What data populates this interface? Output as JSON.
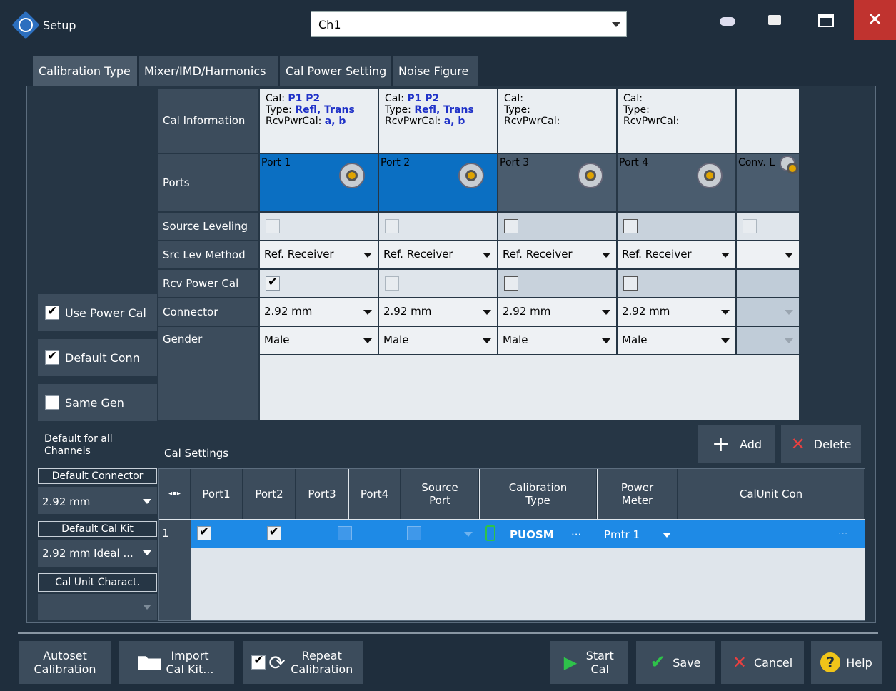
{
  "window": {
    "title": "Setup",
    "channel": "Ch1",
    "close": "✕"
  },
  "tabs": [
    "Calibration Type",
    "Mixer/IMD/Harmonics",
    "Cal Power Setting",
    "Noise Figure"
  ],
  "row_labels": {
    "cal_info": "Cal Information",
    "ports": "Ports",
    "source_leveling": "Source Leveling",
    "src_lev_method": "Src Lev Method",
    "rcv_power_cal": "Rcv Power Cal",
    "connector": "Connector",
    "gender": "Gender"
  },
  "ports": [
    {
      "name": "Port 1",
      "cal_label": "Cal:",
      "cal": "P1 P2",
      "type_label": "Type:",
      "type": "Refl, Trans",
      "rcv_label": "RcvPwrCal:",
      "rcv": "a, b",
      "method": "Ref. Receiver",
      "connector": "2.92 mm",
      "gender": "Male",
      "rcv_checked": true
    },
    {
      "name": "Port 2",
      "cal_label": "Cal:",
      "cal": "P1 P2",
      "type_label": "Type:",
      "type": "Refl, Trans",
      "rcv_label": "RcvPwrCal:",
      "rcv": "a, b",
      "method": "Ref. Receiver",
      "connector": "2.92 mm",
      "gender": "Male",
      "rcv_checked": false
    },
    {
      "name": "Port 3",
      "cal_label": "Cal:",
      "cal": "",
      "type_label": "Type:",
      "type": "",
      "rcv_label": "RcvPwrCal:",
      "rcv": "",
      "method": "Ref. Receiver",
      "connector": "2.92 mm",
      "gender": "Male",
      "rcv_checked": false
    },
    {
      "name": "Port 4",
      "cal_label": "Cal:",
      "cal": "",
      "type_label": "Type:",
      "type": "",
      "rcv_label": "RcvPwrCal:",
      "rcv": "",
      "method": "Ref. Receiver",
      "connector": "2.92 mm",
      "gender": "Male",
      "rcv_checked": false
    },
    {
      "name": "Conv. L",
      "cal_label": "",
      "cal": "",
      "type_label": "",
      "type": "",
      "rcv_label": "",
      "rcv": "",
      "method": "",
      "connector": "",
      "gender": "",
      "rcv_checked": false
    }
  ],
  "left": {
    "use_power_cal": "Use Power Cal",
    "default_conn": "Default Conn",
    "same_gen": "Same Gen",
    "default_for": "Default for all Channels",
    "default_connector_label": "Default Connector",
    "default_connector": "2.92 mm",
    "default_cal_kit_label": "Default Cal Kit",
    "default_cal_kit": "2.92 mm Ideal ...",
    "cal_unit_charact": "Cal Unit Charact."
  },
  "cal_settings": {
    "title": "Cal Settings",
    "add": "Add",
    "delete": "Delete",
    "columns": [
      "Port1",
      "Port2",
      "Port3",
      "Port4",
      "Source Port",
      "Calibration Type",
      "Power Meter",
      "CalUnit Con"
    ],
    "row": {
      "index": "1",
      "cal_type": "PUOSM",
      "ellipsis": "···",
      "power_meter": "Pmtr 1",
      "calunit": "···"
    }
  },
  "buttons": {
    "autoset": "Autoset Calibration",
    "import": "Import Cal Kit...",
    "repeat": "Repeat Calibration",
    "start": "Start Cal",
    "save": "Save",
    "cancel": "Cancel",
    "help": "Help"
  },
  "colors": {
    "port_active": "#0b6fc2",
    "port_inactive": "#4a5c6e",
    "selected_row": "#1e8ae6"
  }
}
